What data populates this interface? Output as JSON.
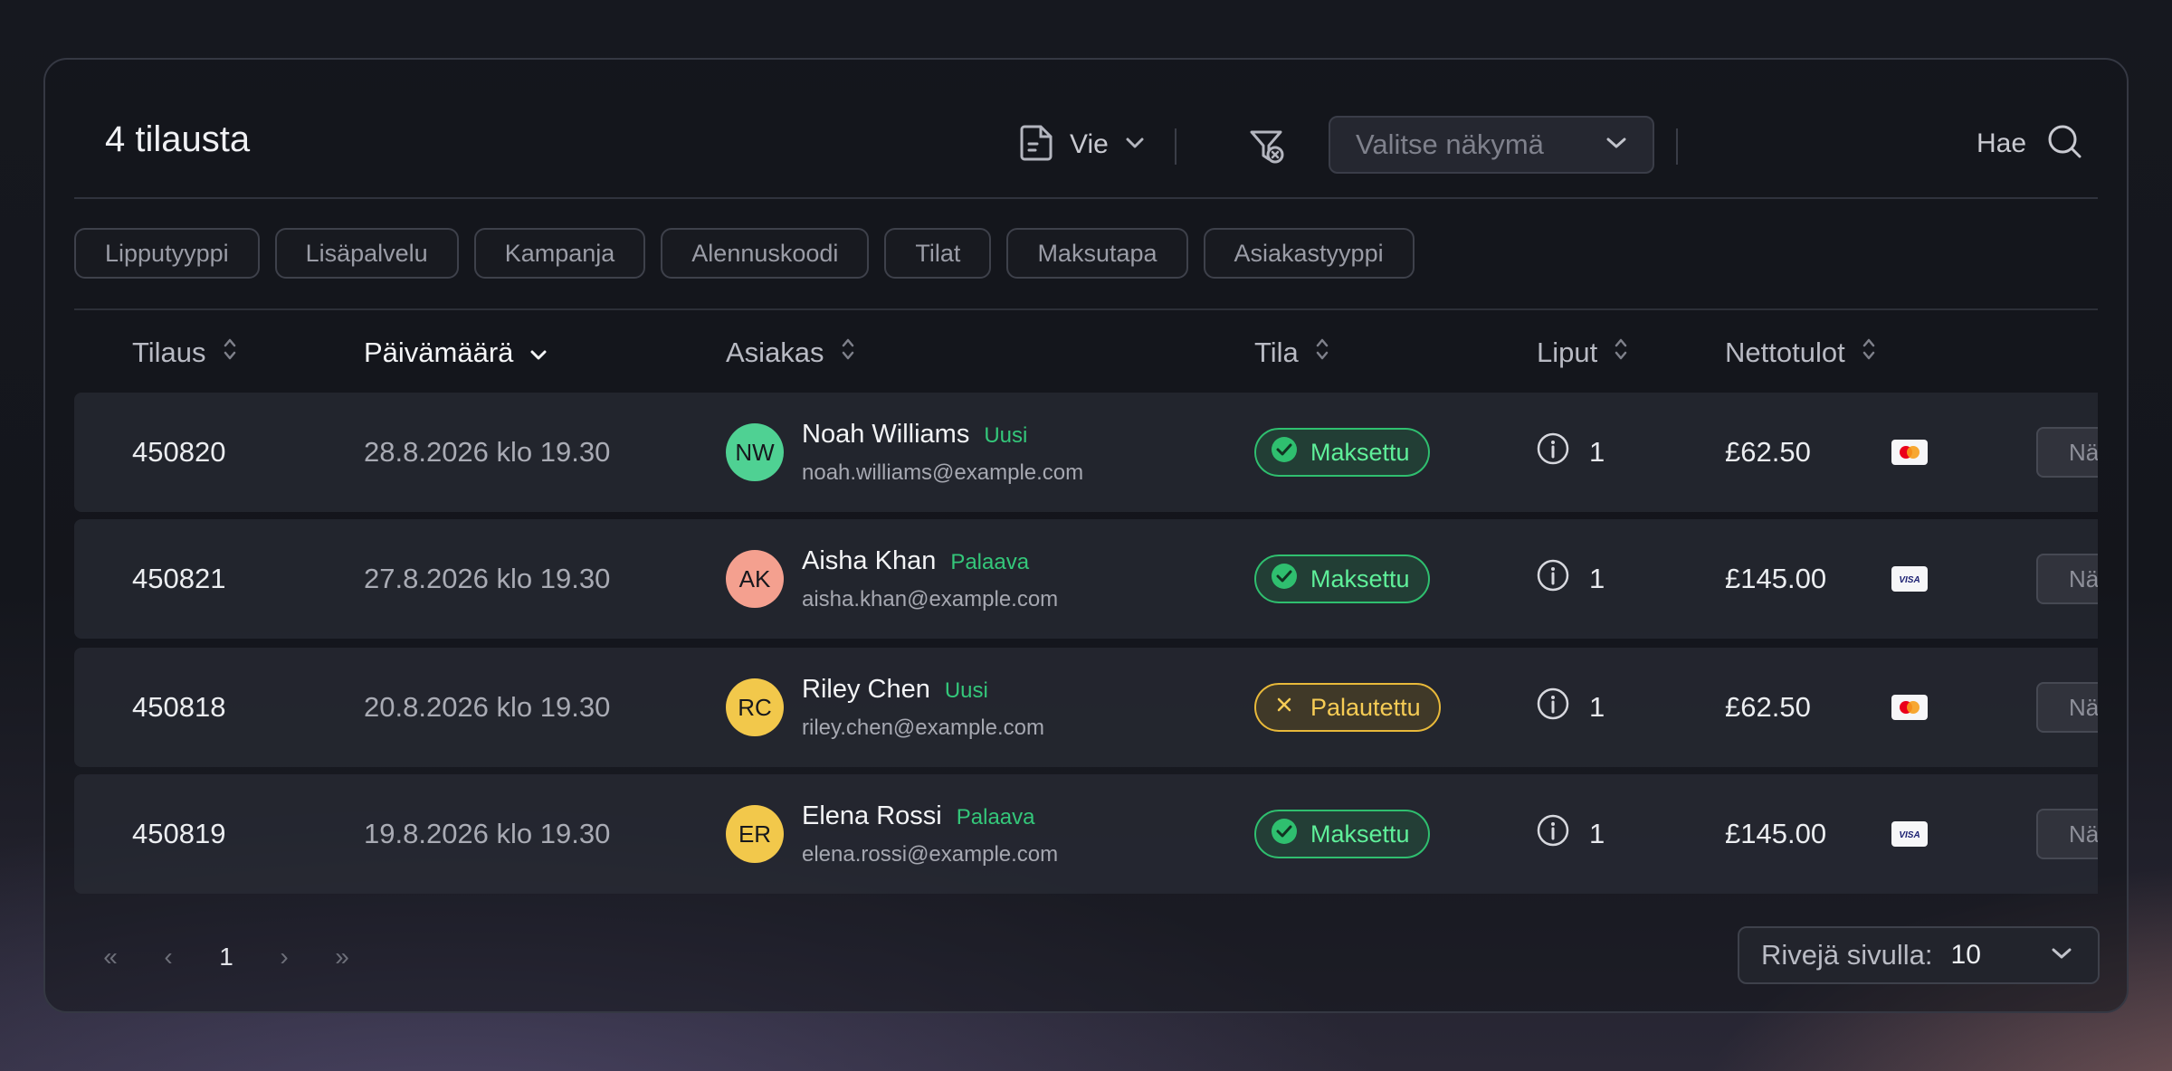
{
  "header": {
    "title": "4 tilausta",
    "export_label": "Vie",
    "view_placeholder": "Valitse näkymä",
    "search_label": "Hae"
  },
  "filters": [
    "Lipputyyppi",
    "Lisäpalvelu",
    "Kampanja",
    "Alennuskoodi",
    "Tilat",
    "Maksutapa",
    "Asiakastyyppi"
  ],
  "columns": {
    "order": "Tilaus",
    "date": "Päivämäärä",
    "customer": "Asiakas",
    "status": "Tila",
    "tickets": "Liput",
    "net": "Nettotulot"
  },
  "rows": [
    {
      "order": "450820",
      "date": "28.8.2026 klo 19.30",
      "initials": "NW",
      "avatar_color": "#4fd193",
      "name": "Noah Williams",
      "tag": "Uusi",
      "email": "noah.williams@example.com",
      "status": "Maksettu",
      "status_kind": "paid",
      "tickets": "1",
      "net": "£62.50",
      "card": "mastercard",
      "action": "Näytä"
    },
    {
      "order": "450821",
      "date": "27.8.2026 klo 19.30",
      "initials": "AK",
      "avatar_color": "#f4a08f",
      "name": "Aisha Khan",
      "tag": "Palaava",
      "email": "aisha.khan@example.com",
      "status": "Maksettu",
      "status_kind": "paid",
      "tickets": "1",
      "net": "£145.00",
      "card": "visa",
      "action": "Näytä"
    },
    {
      "order": "450818",
      "date": "20.8.2026 klo 19.30",
      "initials": "RC",
      "avatar_color": "#f2c84b",
      "name": "Riley Chen",
      "tag": "Uusi",
      "email": "riley.chen@example.com",
      "status": "Palautettu",
      "status_kind": "refund",
      "tickets": "1",
      "net": "£62.50",
      "card": "mastercard",
      "action": "Näytä"
    },
    {
      "order": "450819",
      "date": "19.8.2026 klo 19.30",
      "initials": "ER",
      "avatar_color": "#f2c84b",
      "name": "Elena Rossi",
      "tag": "Palaava",
      "email": "elena.rossi@example.com",
      "status": "Maksettu",
      "status_kind": "paid",
      "tickets": "1",
      "net": "£145.00",
      "card": "visa",
      "action": "Näytä"
    }
  ],
  "pagination": {
    "first": "«",
    "prev": "‹",
    "page": "1",
    "next": "›",
    "last": "»"
  },
  "rows_per_page": {
    "label": "Rivejä sivulla:",
    "value": "10"
  }
}
